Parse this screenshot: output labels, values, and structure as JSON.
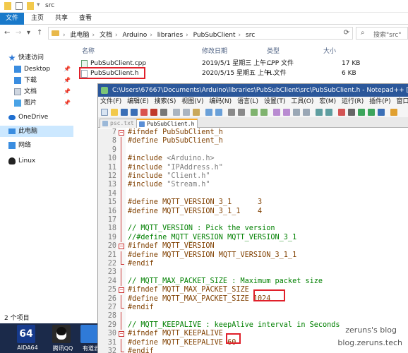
{
  "explorer": {
    "title": "src",
    "ribbon_tabs": [
      "文件",
      "主页",
      "共享",
      "查看"
    ],
    "breadcrumb": [
      "此电脑",
      "文档",
      "Arduino",
      "libraries",
      "PubSubClient",
      "src"
    ],
    "search_placeholder": "搜索\"src\"",
    "nav": [
      {
        "label": "快速访问",
        "icon": "star-icon",
        "pinned": false
      },
      {
        "label": "Desktop",
        "icon": "desktop-icon",
        "pinned": true
      },
      {
        "label": "下载",
        "icon": "download-icon",
        "pinned": true
      },
      {
        "label": "文档",
        "icon": "document-icon",
        "pinned": true
      },
      {
        "label": "图片",
        "icon": "picture-icon",
        "pinned": true
      },
      {
        "label": "OneDrive",
        "icon": "cloud-icon",
        "pinned": false
      },
      {
        "label": "此电脑",
        "icon": "computer-icon",
        "pinned": false
      },
      {
        "label": "网络",
        "icon": "network-icon",
        "pinned": false
      },
      {
        "label": "Linux",
        "icon": "linux-icon",
        "pinned": false
      }
    ],
    "columns": {
      "name": "名称",
      "date": "修改日期",
      "type": "类型",
      "size": "大小"
    },
    "files": [
      {
        "name": "PubSubClient.cpp",
        "date": "2019/5/1 星期三 上午...",
        "type": "CPP 文件",
        "size": "17 KB"
      },
      {
        "name": "PubSubClient.h",
        "date": "2020/5/15 星期五 上午...",
        "type": "H 文件",
        "size": "6 KB"
      }
    ],
    "status": "2 个项目"
  },
  "taskbar": {
    "apps": [
      {
        "name": "AIDA64",
        "tile_text": "64"
      },
      {
        "name": "腾讯QQ",
        "tile_text": ""
      },
      {
        "name": "有道云",
        "tile_text": ""
      }
    ]
  },
  "notepad": {
    "title": "C:\\Users\\67667\\Documents\\Arduino\\libraries\\PubSubClient\\src\\PubSubClient.h - Notepad++ [Administrator]",
    "menu": [
      "文件(F)",
      "编辑(E)",
      "搜索(S)",
      "视图(V)",
      "编码(N)",
      "语言(L)",
      "设置(T)",
      "工具(O)",
      "宏(M)",
      "运行(R)",
      "插件(P)",
      "窗口(W)",
      "?"
    ],
    "tabs": [
      {
        "label": "psc.txt",
        "active": false
      },
      {
        "label": "PubSubClient.h",
        "active": true
      }
    ],
    "lines": [
      {
        "n": "7",
        "fold": "open",
        "parts": [
          {
            "t": "#ifndef PubSubClient_h",
            "c": "c-pp"
          }
        ]
      },
      {
        "n": "8",
        "fold": "bar",
        "parts": [
          {
            "t": "#define PubSubClient_h",
            "c": "c-pp"
          }
        ]
      },
      {
        "n": "9",
        "fold": "bar",
        "parts": []
      },
      {
        "n": "10",
        "fold": "bar",
        "parts": [
          {
            "t": "#include ",
            "c": "c-pp"
          },
          {
            "t": "<Arduino.h>",
            "c": "c-str"
          }
        ]
      },
      {
        "n": "11",
        "fold": "bar",
        "parts": [
          {
            "t": "#include ",
            "c": "c-pp"
          },
          {
            "t": "\"IPAddress.h\"",
            "c": "c-str"
          }
        ]
      },
      {
        "n": "12",
        "fold": "bar",
        "parts": [
          {
            "t": "#include ",
            "c": "c-pp"
          },
          {
            "t": "\"Client.h\"",
            "c": "c-str"
          }
        ]
      },
      {
        "n": "13",
        "fold": "bar",
        "parts": [
          {
            "t": "#include ",
            "c": "c-pp"
          },
          {
            "t": "\"Stream.h\"",
            "c": "c-str"
          }
        ]
      },
      {
        "n": "14",
        "fold": "bar",
        "parts": []
      },
      {
        "n": "15",
        "fold": "bar",
        "parts": [
          {
            "t": "#define MQTT_VERSION_3_1      ",
            "c": "c-pp"
          },
          {
            "t": "3",
            "c": "c-pp"
          }
        ]
      },
      {
        "n": "16",
        "fold": "bar",
        "parts": [
          {
            "t": "#define MQTT_VERSION_3_1_1    ",
            "c": "c-pp"
          },
          {
            "t": "4",
            "c": "c-pp"
          }
        ]
      },
      {
        "n": "17",
        "fold": "bar",
        "parts": []
      },
      {
        "n": "18",
        "fold": "bar",
        "parts": [
          {
            "t": "// MQTT_VERSION : Pick the version",
            "c": "c-cm"
          }
        ]
      },
      {
        "n": "19",
        "fold": "bar",
        "parts": [
          {
            "t": "//#define MQTT_VERSION MQTT_VERSION_3_1",
            "c": "c-cm"
          }
        ]
      },
      {
        "n": "20",
        "fold": "open",
        "parts": [
          {
            "t": "#ifndef MQTT_VERSION",
            "c": "c-pp"
          }
        ]
      },
      {
        "n": "21",
        "fold": "bar",
        "parts": [
          {
            "t": "#define MQTT_VERSION MQTT_VERSION_3_1_1",
            "c": "c-pp"
          }
        ]
      },
      {
        "n": "22",
        "fold": "end",
        "parts": [
          {
            "t": "#endif",
            "c": "c-pp"
          }
        ]
      },
      {
        "n": "23",
        "fold": "bar",
        "parts": []
      },
      {
        "n": "24",
        "fold": "bar",
        "parts": [
          {
            "t": "// MQTT_MAX_PACKET_SIZE : Maximum packet size",
            "c": "c-cm"
          }
        ]
      },
      {
        "n": "25",
        "fold": "open",
        "parts": [
          {
            "t": "#ifndef MQTT_MAX_PACKET_SIZE",
            "c": "c-pp"
          }
        ]
      },
      {
        "n": "26",
        "fold": "bar",
        "parts": [
          {
            "t": "#define MQTT_MAX_PACKET_SIZE ",
            "c": "c-pp"
          },
          {
            "t": "1024",
            "c": "c-pp"
          }
        ]
      },
      {
        "n": "27",
        "fold": "end",
        "parts": [
          {
            "t": "#endif",
            "c": "c-pp"
          }
        ]
      },
      {
        "n": "28",
        "fold": "bar",
        "parts": []
      },
      {
        "n": "29",
        "fold": "bar",
        "parts": [
          {
            "t": "// MQTT_KEEPALIVE : keepAlive interval in Seconds",
            "c": "c-cm"
          }
        ]
      },
      {
        "n": "30",
        "fold": "open",
        "parts": [
          {
            "t": "#ifndef MQTT_KEEPALIVE",
            "c": "c-pp"
          }
        ]
      },
      {
        "n": "31",
        "fold": "bar",
        "parts": [
          {
            "t": "#define MQTT_KEEPALIVE ",
            "c": "c-pp"
          },
          {
            "t": "60",
            "c": "c-pp"
          }
        ]
      },
      {
        "n": "32",
        "fold": "end",
        "parts": [
          {
            "t": "#endif",
            "c": "c-pp"
          }
        ]
      }
    ]
  },
  "watermark": {
    "line1": "zeruns's blog",
    "line2": "blog.zeruns.tech"
  },
  "colors": {
    "accent": "#1979ca",
    "highlight": "#e0202a",
    "npp_title": "#2b579a"
  }
}
